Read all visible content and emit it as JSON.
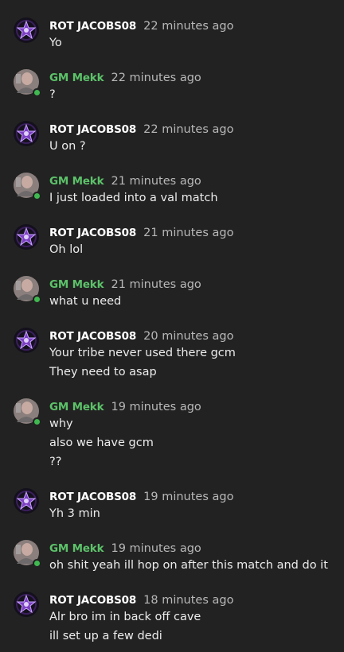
{
  "messages": [
    {
      "author": "ROT JACOBS08",
      "kind": "rot",
      "time": "22 minutes ago",
      "lines": [
        "Yo"
      ]
    },
    {
      "author": "GM Mekk",
      "kind": "gm",
      "time": "22 minutes ago",
      "lines": [
        "?"
      ]
    },
    {
      "author": "ROT JACOBS08",
      "kind": "rot",
      "time": "22 minutes ago",
      "lines": [
        "U on ?"
      ]
    },
    {
      "author": "GM Mekk",
      "kind": "gm",
      "time": "21 minutes ago",
      "lines": [
        "I just loaded into a val match"
      ]
    },
    {
      "author": "ROT JACOBS08",
      "kind": "rot",
      "time": "21 minutes ago",
      "lines": [
        "Oh lol"
      ]
    },
    {
      "author": "GM Mekk",
      "kind": "gm",
      "time": "21 minutes ago",
      "lines": [
        "what u need"
      ]
    },
    {
      "author": "ROT JACOBS08",
      "kind": "rot",
      "time": "20 minutes ago",
      "lines": [
        "Your tribe never used there gcm",
        "They need to asap"
      ]
    },
    {
      "author": "GM Mekk",
      "kind": "gm",
      "time": "19 minutes ago",
      "lines": [
        "why",
        "also we have gcm",
        "??"
      ]
    },
    {
      "author": "ROT JACOBS08",
      "kind": "rot",
      "time": "19 minutes ago",
      "lines": [
        "Yh 3 min"
      ]
    },
    {
      "author": "GM Mekk",
      "kind": "gm",
      "time": "19 minutes ago",
      "lines": [
        "oh shit yeah ill hop on after this match and do it"
      ]
    },
    {
      "author": "ROT JACOBS08",
      "kind": "rot",
      "time": "18 minutes ago",
      "lines": [
        "Alr bro im in back off cave",
        "ill set up a few dedi"
      ]
    }
  ],
  "colors": {
    "background": "#222222",
    "gm_name": "#5cc169",
    "rot_name": "#ffffff",
    "timestamp": "#b8b8b8",
    "online_status": "#3fb950"
  },
  "icons": {
    "rot_avatar": "purple-star-emblem-icon",
    "gm_avatar": "user-photo-icon",
    "status": "online-status-icon"
  }
}
